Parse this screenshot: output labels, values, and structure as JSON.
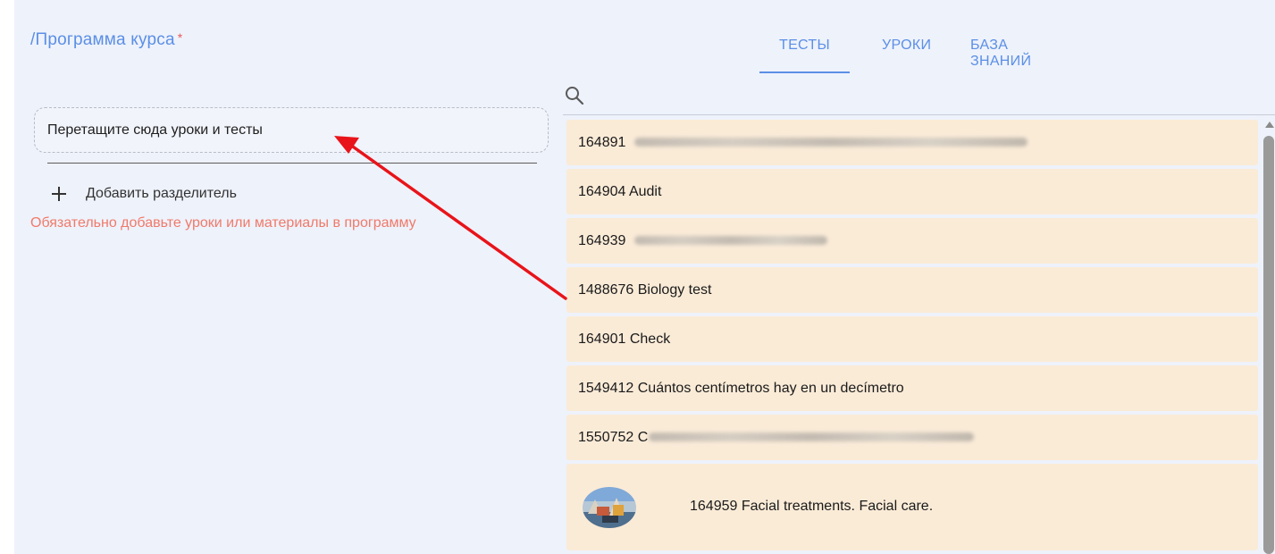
{
  "header": {
    "title": "/Программа курса",
    "required_mark": "*"
  },
  "program": {
    "dropzone_text": "Перетащите сюда уроки и тесты",
    "add_separator_label": "Добавить разделитель",
    "error_text": "Обязательно добавьте уроки или материалы в программу"
  },
  "tabs": [
    {
      "label": "ТЕСТЫ",
      "active": true
    },
    {
      "label": "УРОКИ",
      "active": false
    },
    {
      "label": "БАЗА ЗНАНИЙ",
      "active": false
    }
  ],
  "list": {
    "items": [
      {
        "text": "164891",
        "redacted": true
      },
      {
        "text": "164904 Audit",
        "redacted": false
      },
      {
        "text": "164939",
        "redacted": true
      },
      {
        "text": "1488676 Biology test",
        "redacted": false
      },
      {
        "text": "164901 Check",
        "redacted": false
      },
      {
        "text": "1549412 Cuántos centímetros hay en un decímetro",
        "redacted": false
      },
      {
        "text": "1550752 C",
        "redacted": true
      },
      {
        "text": "164959 Facial treatments. Facial care.",
        "redacted": false,
        "thumbnail": true
      }
    ]
  },
  "icons": {
    "search": "search-icon",
    "plus": "plus-icon",
    "scroll_up": "scroll-up-arrow-icon"
  },
  "colors": {
    "accent": "#5b8fe6",
    "error": "#f07a6a",
    "required": "#e85c5c",
    "item_bg": "#faebd7",
    "panel_bg": "#eef2fb",
    "annotation_arrow": "#e8141a"
  }
}
